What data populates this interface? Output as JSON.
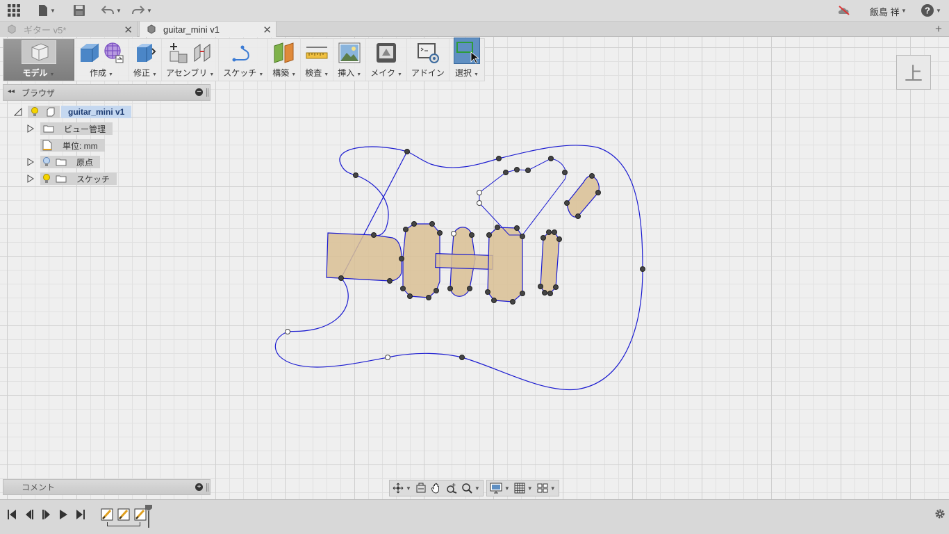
{
  "user": {
    "name": "飯島 祥"
  },
  "tabs": [
    {
      "label": "ギター v5*",
      "active": false
    },
    {
      "label": "guitar_mini v1",
      "active": true
    }
  ],
  "toolbar": {
    "model": "モデル",
    "create": "作成",
    "modify": "修正",
    "assemble": "アセンブリ",
    "sketch": "スケッチ",
    "construct": "構築",
    "inspect": "検査",
    "insert": "挿入",
    "make": "メイク",
    "addins": "アドイン",
    "select": "選択"
  },
  "browser": {
    "title": "ブラウザ",
    "root": "guitar_mini v1",
    "items": [
      {
        "label": "ビュー管理"
      },
      {
        "label": "単位: mm"
      },
      {
        "label": "原点"
      },
      {
        "label": "スケッチ"
      }
    ]
  },
  "comments": {
    "title": "コメント"
  },
  "viewcube": {
    "face": "上"
  },
  "colors": {
    "sketch_line": "#1a1ad0",
    "profile_fill": "#d9bf94",
    "accent_blue": "#5f8fc2"
  }
}
